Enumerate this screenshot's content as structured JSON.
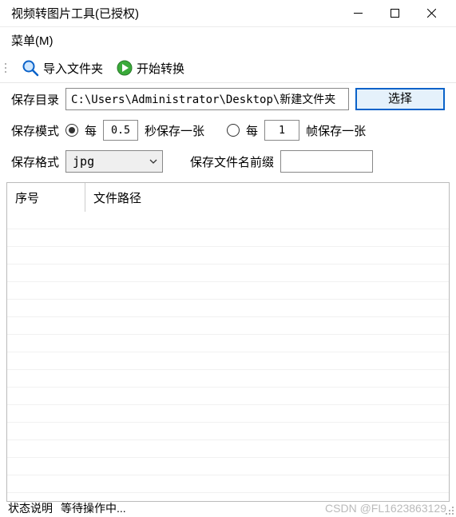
{
  "window": {
    "title": "视频转图片工具(已授权)"
  },
  "menubar": {
    "menu": "菜单(M)"
  },
  "toolbar": {
    "import_folder": "导入文件夹",
    "start_convert": "开始转换"
  },
  "form": {
    "save_dir_label": "保存目录",
    "save_dir_value": "C:\\Users\\Administrator\\Desktop\\新建文件夹（",
    "select_btn": "选择",
    "save_mode_label": "保存模式",
    "every1": "每",
    "seconds_value": "0.5",
    "seconds_suffix": "秒保存一张",
    "every2": "每",
    "frames_value": "1",
    "frames_suffix": "帧保存一张",
    "save_format_label": "保存格式",
    "format_value": "jpg",
    "prefix_label": "保存文件名前缀",
    "prefix_value": ""
  },
  "table": {
    "col_seq": "序号",
    "col_path": "文件路径"
  },
  "status": {
    "label": "状态说明",
    "text": "等待操作中..."
  },
  "watermark": "CSDN @FL1623863129"
}
